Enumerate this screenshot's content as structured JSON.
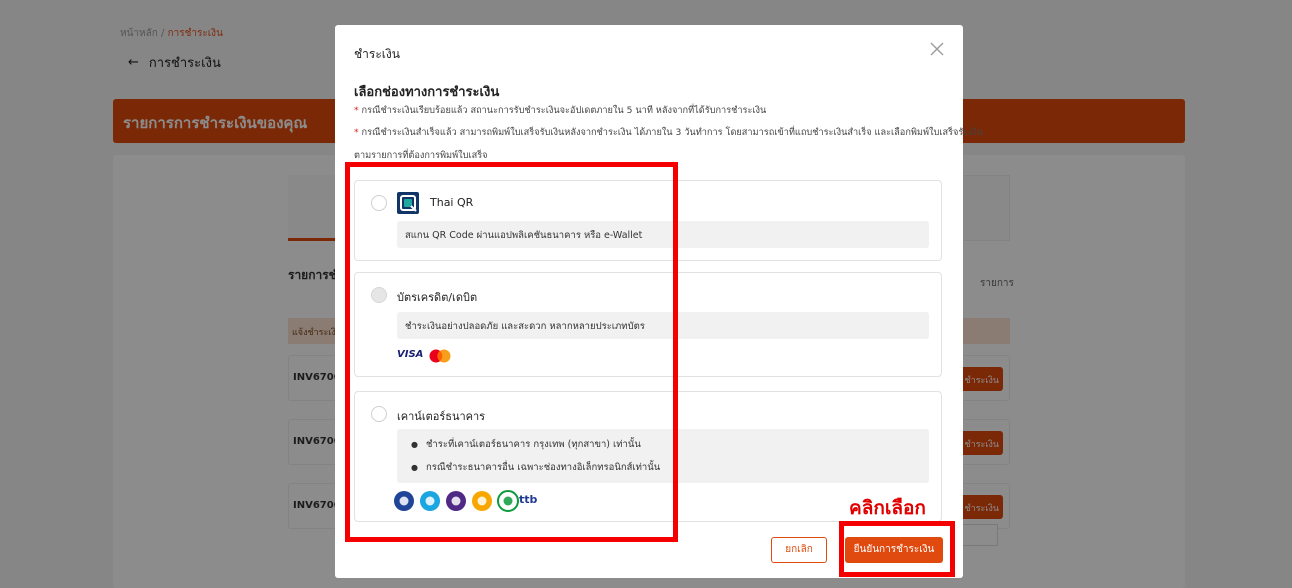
{
  "background": {
    "breadcrumb": {
      "home": "หน้าหลัก",
      "separator": "/",
      "current": "การชำระเงิน"
    },
    "back_label": "การชำระเงิน",
    "banner_title": "รายการการชำระเงินของคุณ",
    "section_title": "รายการชำ",
    "right_label": "รายการ",
    "table_header": "แจ้งชำระเงิน",
    "rows": [
      {
        "invoice": "INV6700",
        "action": "ชำระเงิน"
      },
      {
        "invoice": "INV6700",
        "action": "ชำระเงิน"
      },
      {
        "invoice": "INV6700",
        "action": "ชำระเงิน"
      }
    ]
  },
  "modal": {
    "title": "ชำระเงิน",
    "heading": "เลือกช่องทางการชำระเงิน",
    "notes": [
      "กรณีชำระเงินเรียบร้อยแล้ว สถานะการรับชำระเงินจะอัปเดตภายใน 5 นาที หลังจากที่ได้รับการชำระเงิน",
      "กรณีชำระเงินสำเร็จแล้ว สามารถพิมพ์ใบเสร็จรับเงินหลังจากชำระเงิน ได้ภายใน 3 วันทำการ โดยสามารถเข้าที่แถบชำระเงินสำเร็จ และเลือกพิมพ์ใบเสร็จรับเงิน",
      "ตามรายการที่ต้องการพิมพ์ใบเสร็จ"
    ],
    "note_marker": "*",
    "options": {
      "qr": {
        "title": "Thai QR",
        "description": "สแกน QR Code ผ่านแอปพลิเคชันธนาคาร หรือ e-Wallet",
        "icon": "thai-qr-icon"
      },
      "card": {
        "title": "บัตรเครดิต/เดบิต",
        "description": "ชำระเงินอย่างปลอดภัย และสะดวก หลากหลายประเภทบัตร",
        "brand_visa": "VISA"
      },
      "counter": {
        "title": "เคาน์เตอร์ธนาคาร",
        "bullets": [
          "ชำระที่เคาน์เตอร์ธนาคาร กรุงเทพ (ทุกสาขา) เท่านั้น",
          "กรณีชำระธนาคารอื่น เฉพาะช่องทางอิเล็กทรอนิกส์เท่านั้น"
        ],
        "ttb_label": "ttb",
        "bank_colors": [
          "#1e4598",
          "#1ba5e1",
          "#4e2a84",
          "#f7a700",
          "#0a9b3c"
        ]
      }
    },
    "cancel_label": "ยกเลิก",
    "confirm_label": "ยืนยันการชำระเงิน"
  },
  "annotation": {
    "label": "คลิกเลือก",
    "color": "#f40000"
  }
}
